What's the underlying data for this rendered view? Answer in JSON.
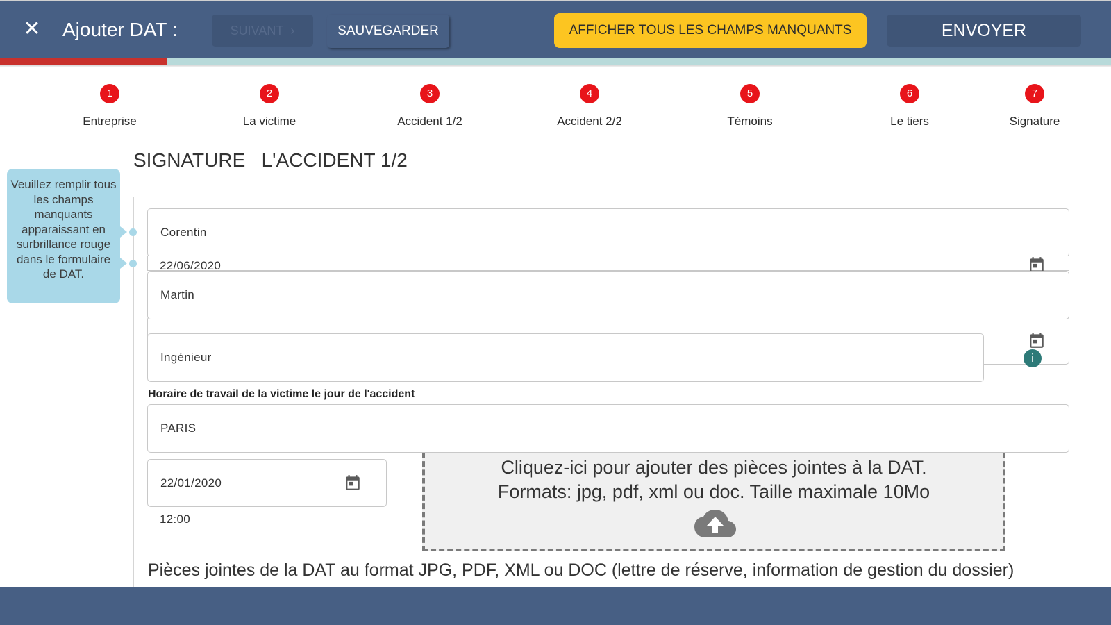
{
  "header": {
    "close_icon": "close-icon",
    "title": "Ajouter DAT :",
    "next_label": "SUIVANT",
    "next_icon": "chevron-right-icon",
    "save_label": "SAUVEGARDER",
    "missing_fields_label": "AFFICHER TOUS LES CHAMPS MANQUANTS",
    "send_label": "ENVOYER",
    "progress_fraction": 0.15,
    "colors": {
      "bar": "#475f84",
      "accent": "#fcc521",
      "progress": "#c8312c",
      "step": "#e8141a"
    }
  },
  "steps": [
    {
      "number": "1",
      "label": "Entreprise"
    },
    {
      "number": "2",
      "label": "La victime"
    },
    {
      "number": "3",
      "label": "Accident 1/2"
    },
    {
      "number": "4",
      "label": "Accident 2/2"
    },
    {
      "number": "5",
      "label": "Témoins"
    },
    {
      "number": "6",
      "label": "Le tiers"
    },
    {
      "number": "7",
      "label": "Signature"
    }
  ],
  "page": {
    "heading": "SIGNATURE   L'ACCIDENT 1/2",
    "tooltip": "Veuillez remplir tous les champs manquants apparaissant en surbrillance rouge dans le formulaire de DAT."
  },
  "form": {
    "first_name": "Corentin",
    "date_1": "22/06/2020",
    "last_name": "Martin",
    "job": "Ingénieur",
    "work_hours_label": "Horaire de travail de la victime le jour de l'accident",
    "city": "PARIS",
    "date_2": "22/01/2020",
    "time": "12:00",
    "calendar_icon": "calendar-icon",
    "info_icon": "info-icon",
    "info_text": "i"
  },
  "upload": {
    "line1": "Cliquez-ici pour ajouter des pièces jointes à la DAT.",
    "line2": "Formats: jpg, pdf, xml ou doc. Taille maximale 10Mo",
    "icon": "cloud-upload-icon"
  },
  "attachments_label": "Pièces jointes de la DAT au format JPG, PDF, XML ou DOC (lettre de réserve, information de gestion du dossier)"
}
